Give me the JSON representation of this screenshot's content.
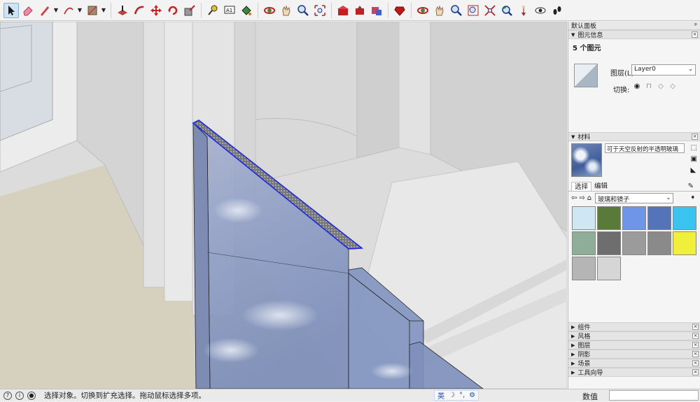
{
  "toolbar": {
    "icons": [
      "select-icon",
      "eraser-icon",
      "pencil-line-icon",
      "arc-icon",
      "rectangle-icon",
      "push-pull-icon",
      "follow-me-icon",
      "move-icon",
      "rotate-icon",
      "scale-icon",
      "tape-measure-icon",
      "text-icon",
      "paint-bucket-icon",
      "orbit-icon",
      "pan-icon",
      "zoom-icon",
      "zoom-extents-icon",
      "warehouse-icon",
      "share-model-icon",
      "extension-icon",
      "ruby-icon",
      "orbit2-icon",
      "pan2-icon",
      "zoom2-icon",
      "zoom-window-icon",
      "zoom-extents2-icon",
      "previous-view-icon",
      "position-camera-icon",
      "look-around-icon",
      "walk-icon"
    ]
  },
  "tray": {
    "title": "默认面板",
    "pin": "ᵖ",
    "entity_panel": {
      "header": "图元信息",
      "count": "5 个图元",
      "layer_label": "图层(L):",
      "layer_value": "Layer0",
      "toggle_label": "切换:"
    },
    "materials_panel": {
      "header": "材料",
      "material_name": "可于天空反射的半透明玻璃",
      "tab_select": "选择",
      "tab_edit": "编辑",
      "library": "玻璃和镜子",
      "swatches": [
        "#cfe6f3",
        "#5a7a3a",
        "#6f95e8",
        "#5473b8",
        "#38c4ef",
        "#8fae9a",
        "#6e6e6e",
        "#9b9b9b",
        "#8a8a8a",
        "#f0f03a",
        "#b5b5b5",
        "#d6d6d6"
      ]
    },
    "collapsed_panels": [
      "组件",
      "风格",
      "图层",
      "阴影",
      "场景",
      "工具向导"
    ]
  },
  "status": {
    "message": "选择对象。切换到扩充选择。拖动鼠标选择多项。",
    "ime": [
      "英",
      "☽",
      "°,",
      "⚙"
    ],
    "measure_label": "数值",
    "measure_value": ""
  }
}
